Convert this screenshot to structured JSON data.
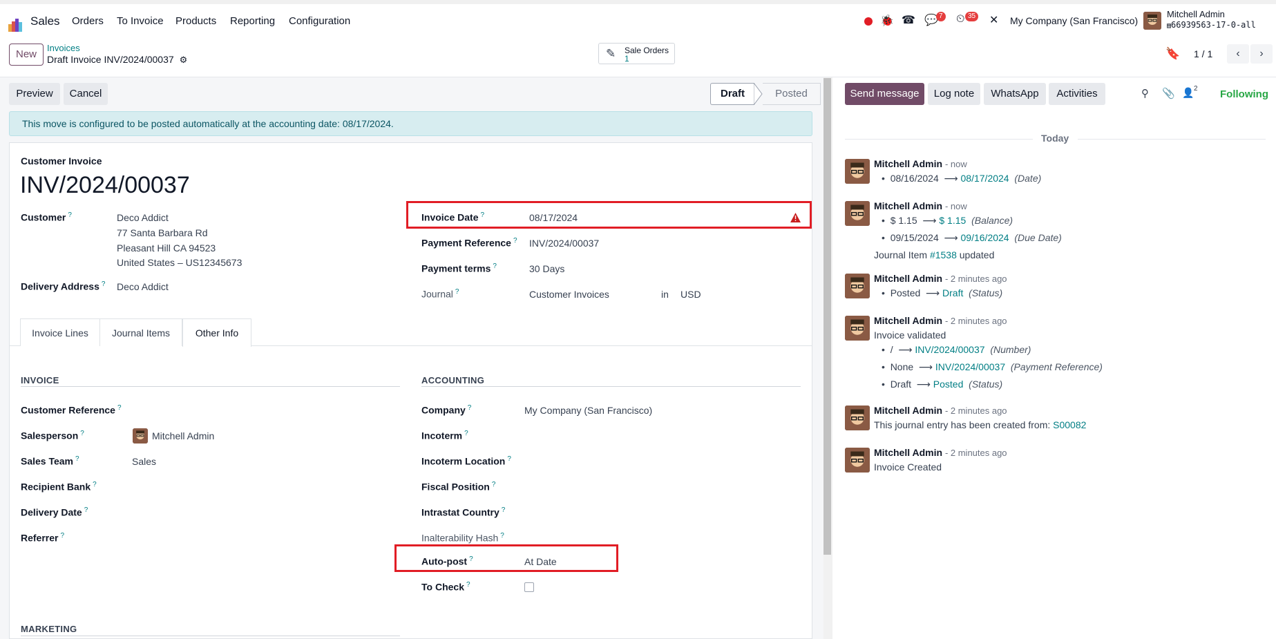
{
  "nav": {
    "app_name": "Sales",
    "menu": [
      "Orders",
      "To Invoice",
      "Products",
      "Reporting",
      "Configuration"
    ],
    "messages_badge": "7",
    "activities_badge": "35",
    "company": "My Company (San Francisco)",
    "user_name": "Mitchell Admin",
    "db_name": "66939563-17-0-all"
  },
  "control": {
    "new_label": "New",
    "breadcrumb_parent": "Invoices",
    "record_title": "Draft Invoice INV/2024/00037",
    "smart_button_label": "Sale Orders",
    "smart_button_count": "1",
    "pager": "1 / 1"
  },
  "actions": {
    "preview": "Preview",
    "cancel": "Cancel",
    "status": [
      "Draft",
      "Posted"
    ],
    "active_status": "Draft"
  },
  "alert": "This move is configured to be posted automatically at the accounting date: 08/17/2024.",
  "invoice": {
    "type_label": "Customer Invoice",
    "number": "INV/2024/00037",
    "customer_label": "Customer",
    "customer_name": "Deco Addict",
    "address1": "77 Santa Barbara Rd",
    "address2": "Pleasant Hill CA 94523",
    "address3": "United States – US12345673",
    "delivery_label": "Delivery Address",
    "delivery_value": "Deco Addict",
    "invoice_date_label": "Invoice Date",
    "invoice_date": "08/17/2024",
    "payment_ref_label": "Payment Reference",
    "payment_ref": "INV/2024/00037",
    "payment_terms_label": "Payment terms",
    "payment_terms": "30 Days",
    "journal_label": "Journal",
    "journal": "Customer Invoices",
    "journal_in": "in",
    "currency": "USD"
  },
  "tabs": [
    "Invoice Lines",
    "Journal Items",
    "Other Info"
  ],
  "other_info": {
    "invoice_section": "INVOICE",
    "accounting_section": "ACCOUNTING",
    "marketing_section": "MARKETING",
    "customer_reference_label": "Customer Reference",
    "salesperson_label": "Salesperson",
    "salesperson": "Mitchell Admin",
    "sales_team_label": "Sales Team",
    "sales_team": "Sales",
    "recipient_bank_label": "Recipient Bank",
    "delivery_date_label": "Delivery Date",
    "referrer_label": "Referrer",
    "company_label": "Company",
    "company": "My Company (San Francisco)",
    "incoterm_label": "Incoterm",
    "incoterm_location_label": "Incoterm Location",
    "fiscal_position_label": "Fiscal Position",
    "intrastat_label": "Intrastat Country",
    "hash_label": "Inalterability Hash",
    "autopost_label": "Auto-post",
    "autopost": "At Date",
    "to_check_label": "To Check"
  },
  "chatter": {
    "send_message": "Send message",
    "log_note": "Log note",
    "whatsapp": "WhatsApp",
    "activities": "Activities",
    "followers_count": "2",
    "following": "Following",
    "today": "Today",
    "messages": [
      {
        "author": "Mitchell Admin",
        "time": "- now"
      },
      {
        "author": "Mitchell Admin",
        "time": "- now"
      },
      {
        "author": "Mitchell Admin",
        "time": "- 2 minutes ago"
      },
      {
        "author": "Mitchell Admin",
        "time": "- 2 minutes ago"
      },
      {
        "author": "Mitchell Admin",
        "time": "- 2 minutes ago"
      },
      {
        "author": "Mitchell Admin",
        "time": "- 2 minutes ago"
      }
    ],
    "m1": {
      "old": "08/16/2024",
      "new": "08/17/2024",
      "field": "(Date)"
    },
    "m2": {
      "old1": "$ 1.15",
      "new1": "$ 1.15",
      "field1": "(Balance)",
      "old2": "09/15/2024",
      "new2": "09/16/2024",
      "field2": "(Due Date)",
      "note_pre": "Journal Item",
      "note_link": "#1538",
      "note_post": "updated"
    },
    "m3": {
      "old": "Posted",
      "new": "Draft",
      "field": "(Status)"
    },
    "m4": {
      "body": "Invoice validated",
      "old1": "/",
      "new1": "INV/2024/00037",
      "field1": "(Number)",
      "old2": "None",
      "new2": "INV/2024/00037",
      "field2": "(Payment Reference)",
      "old3": "Draft",
      "new3": "Posted",
      "field3": "(Status)"
    },
    "m5": {
      "body": "This journal entry has been created from:",
      "link": "S00082"
    },
    "m6": {
      "body": "Invoice Created"
    }
  },
  "colors": {
    "brand": "#714b67",
    "link": "#017e84",
    "highlight": "#e11d25"
  }
}
